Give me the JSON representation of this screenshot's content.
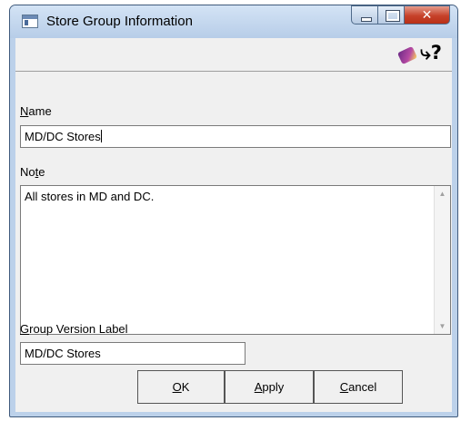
{
  "window": {
    "title": "Store Group Information",
    "close_glyph": "✕"
  },
  "toolbar": {
    "book_icon": "book-icon",
    "help_glyph": "⤷?",
    "help_icon": "context-help-icon"
  },
  "form": {
    "name": {
      "label_u": "N",
      "label_rest": "ame",
      "value": "MD/DC Stores"
    },
    "note": {
      "label_pre": "No",
      "label_u": "t",
      "label_rest": "e",
      "value": "All stores in MD and DC."
    },
    "group_version": {
      "label_u": "G",
      "label_rest": "roup Version Label",
      "value": "MD/DC Stores"
    }
  },
  "buttons": {
    "ok": {
      "u": "O",
      "rest": "K"
    },
    "apply": {
      "u": "A",
      "rest": "pply"
    },
    "cancel": {
      "u": "C",
      "rest": "ancel"
    }
  },
  "scrollbar": {
    "up": "▲",
    "down": "▼"
  }
}
